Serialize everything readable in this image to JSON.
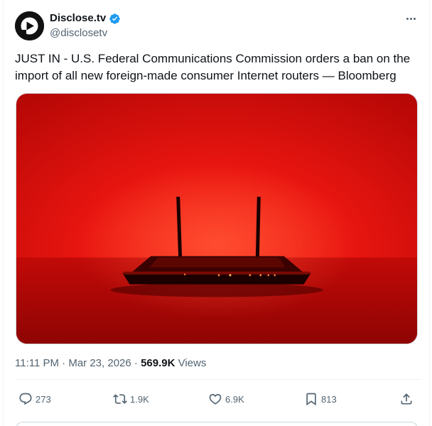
{
  "author": {
    "display_name": "Disclose.tv",
    "handle": "@disclosetv",
    "verified": true
  },
  "tweet": {
    "text": "JUST IN - U.S. Federal Communications Commission orders a ban on the import of all new foreign-made consumer Internet routers — Bloomberg"
  },
  "meta": {
    "time": "11:11 PM",
    "separator": " · ",
    "date": "Mar 23, 2026",
    "views_count": "569.9K",
    "views_label": " Views"
  },
  "actions": {
    "replies": "273",
    "reposts": "1.9K",
    "likes": "6.9K",
    "bookmarks": "813"
  },
  "icons": {
    "avatar": "disclose-logo-icon",
    "verified": "verified-badge-icon",
    "more": "more-options-icon",
    "reply": "reply-icon",
    "repost": "repost-icon",
    "like": "heart-icon",
    "bookmark": "bookmark-icon",
    "share": "share-icon"
  },
  "colors": {
    "accent": "#1d9bf0",
    "text_primary": "#0f1419",
    "text_secondary": "#536471",
    "image_red": "#e01010"
  }
}
